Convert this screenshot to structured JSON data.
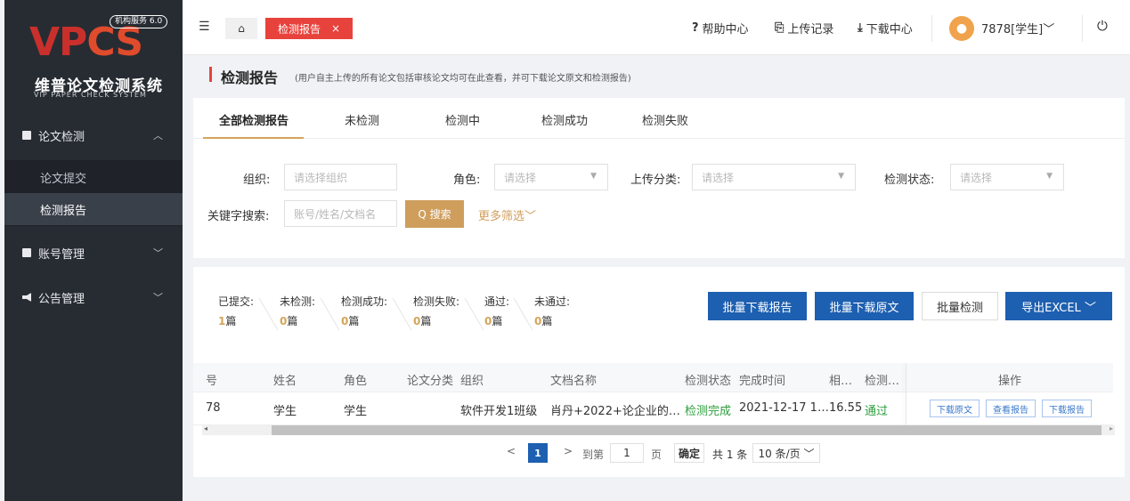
{
  "sidebar": {
    "logo": {
      "letters_1": "VP",
      "letters_2": "CS",
      "badge": "机构服务 6.0",
      "title_cn": "维普论文检测系统",
      "title_en": "VIP PAPER CHECK SYSTEM"
    },
    "groups": [
      {
        "label": "论文检测",
        "chevron": "︿",
        "icon": "document-icon"
      },
      {
        "label": "账号管理",
        "chevron": "﹀",
        "icon": "account-icon"
      },
      {
        "label": "公告管理",
        "chevron": "﹀",
        "icon": "megaphone-icon"
      }
    ],
    "subitems": [
      {
        "label": "论文提交"
      },
      {
        "label": "检测报告"
      }
    ]
  },
  "topbar": {
    "menu_glyph": "☰",
    "home_glyph": "⌂",
    "tab_label": "检测报告",
    "tab_close": "×",
    "help": "帮助中心",
    "help_glyph": "?",
    "upload": "上传记录",
    "upload_glyph": "⎘",
    "download": "下载中心",
    "download_glyph": "⤓",
    "user": "7878[学生]",
    "user_chevron": "﹀",
    "power_glyph": "⏻"
  },
  "pagehead": {
    "title": "检测报告",
    "desc": "(用户自主上传的所有论文包括审核论文均可在此查看，并可下载论文原文和检测报告)"
  },
  "tabs": [
    "全部检测报告",
    "未检测",
    "检测中",
    "检测成功",
    "检测失败"
  ],
  "filters": {
    "org_label": "组织:",
    "org_placeholder": "请选择组织",
    "role_label": "角色:",
    "role_placeholder": "请选择",
    "category_label": "上传分类:",
    "category_placeholder": "请选择",
    "status_label": "检测状态:",
    "status_placeholder": "请选择",
    "keyword_label": "关键字搜索:",
    "keyword_placeholder": "账号/姓名/文档名",
    "search_btn": "Q 搜索",
    "more": "更多筛选﹀",
    "arrow": "▼"
  },
  "stats": [
    {
      "label": "已提交:",
      "num": "1",
      "unit": "篇"
    },
    {
      "label": "未检测:",
      "num": "0",
      "unit": "篇"
    },
    {
      "label": "检测成功:",
      "num": "0",
      "unit": "篇"
    },
    {
      "label": "检测失败:",
      "num": "0",
      "unit": "篇"
    },
    {
      "label": "通过:",
      "num": "0",
      "unit": "篇"
    },
    {
      "label": "未通过:",
      "num": "0",
      "unit": "篇"
    }
  ],
  "actions": {
    "batch_report": "批量下载报告",
    "batch_original": "批量下载原文",
    "batch_check": "批量检测",
    "export": "导出EXCEL ﹀"
  },
  "table": {
    "headers": [
      "号",
      "姓名",
      "角色",
      "论文分类",
      "组织",
      "文档名称",
      "检测状态",
      "完成时间",
      "相…",
      "检测…",
      "操作"
    ],
    "row": [
      "78",
      "学生",
      "学生",
      "",
      "软件开发1班级",
      "肖丹+2022+论企业的…",
      "检测完成",
      "2021-12-17 1…",
      "16.55",
      "通过"
    ],
    "ops": [
      "下载原文",
      "查看报告",
      "下载报告"
    ],
    "scroll_left": "◂",
    "scroll_right": "▸"
  },
  "pager": {
    "prev": "<",
    "current": "1",
    "next": ">",
    "goto": "到第",
    "page_input": "1",
    "page_unit": "页",
    "confirm": "确定",
    "total": "共 1 条",
    "page_size": "10 条/页 ﹀"
  },
  "colors": {
    "accent": "#e8423c",
    "gold": "#cf9e5d",
    "blue": "#1d5fb0",
    "sidebar": "#272c33",
    "green": "#2e9e3e"
  }
}
